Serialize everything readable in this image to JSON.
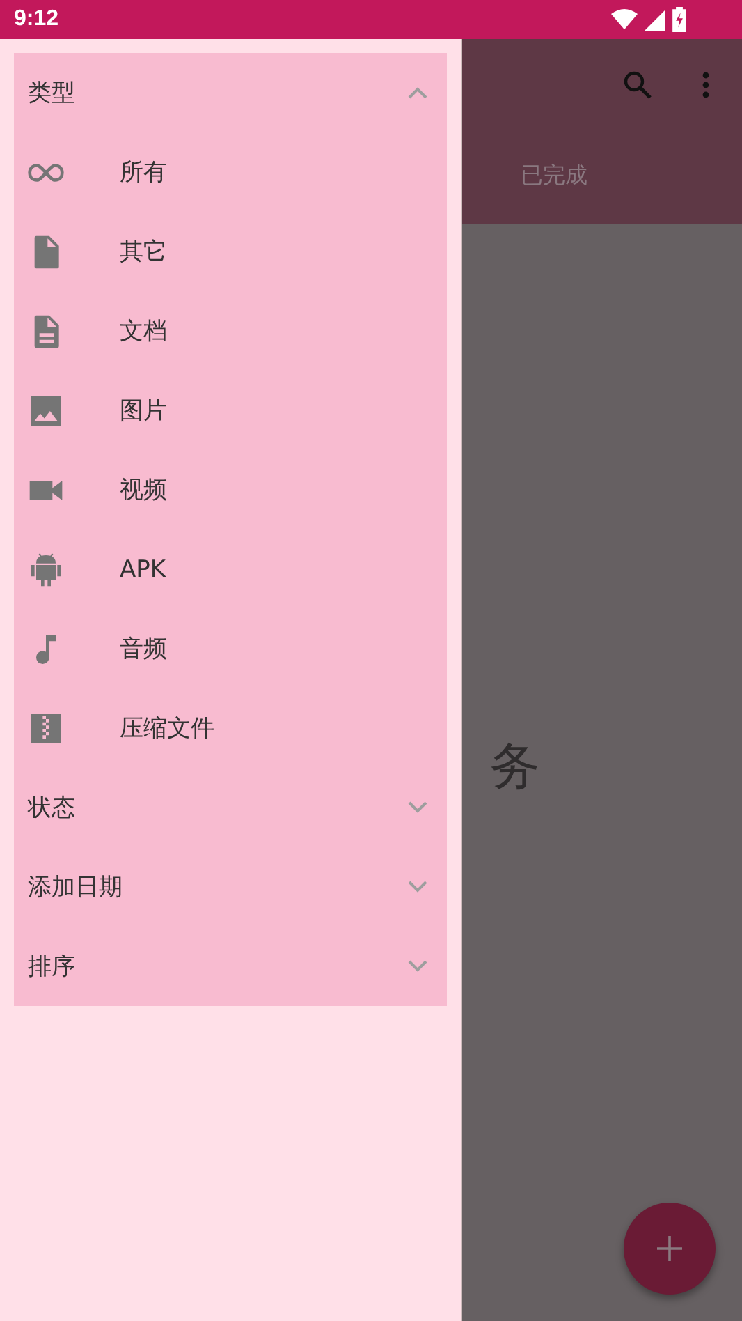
{
  "status_bar": {
    "time": "9:12"
  },
  "app_bar": {
    "tab_label": "已完成"
  },
  "empty_message": "务",
  "filter_drawer": {
    "sections": [
      {
        "title": "类型",
        "expanded": true,
        "items": [
          {
            "label": "所有",
            "kind": "all"
          },
          {
            "label": "其它",
            "kind": "other"
          },
          {
            "label": "文档",
            "kind": "document"
          },
          {
            "label": "图片",
            "kind": "image"
          },
          {
            "label": "视频",
            "kind": "video"
          },
          {
            "label": "APK",
            "kind": "apk"
          },
          {
            "label": "音频",
            "kind": "audio"
          },
          {
            "label": "压缩文件",
            "kind": "archive"
          }
        ]
      },
      {
        "title": "状态",
        "expanded": false
      },
      {
        "title": "添加日期",
        "expanded": false
      },
      {
        "title": "排序",
        "expanded": false
      }
    ]
  }
}
